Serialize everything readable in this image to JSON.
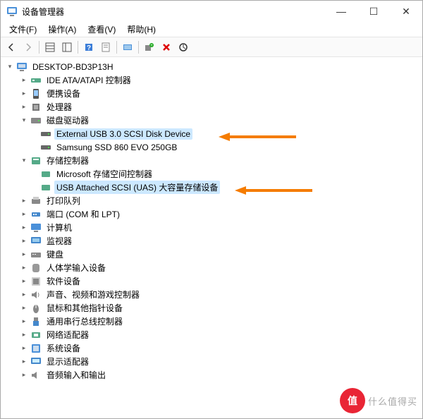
{
  "window_title": "设备管理器",
  "menus": {
    "file": "文件(F)",
    "action": "操作(A)",
    "view": "查看(V)",
    "help": "帮助(H)"
  },
  "root": "DESKTOP-BD3P13H",
  "nodes": {
    "ide": "IDE ATA/ATAPI 控制器",
    "portable": "便携设备",
    "cpu": "处理器",
    "disk": "磁盘驱动器",
    "disk1": "External USB 3.0 SCSI Disk Device",
    "disk2": "Samsung SSD 860 EVO 250GB",
    "storage": "存储控制器",
    "stor1": "Microsoft 存储空间控制器",
    "stor2": "USB Attached SCSI (UAS) 大容量存储设备",
    "printq": "打印队列",
    "ports": "端口 (COM 和 LPT)",
    "computer": "计算机",
    "monitor": "监视器",
    "keyboard": "键盘",
    "hid": "人体学输入设备",
    "software": "软件设备",
    "sound": "声音、视频和游戏控制器",
    "mouse": "鼠标和其他指针设备",
    "usb": "通用串行总线控制器",
    "network": "网络适配器",
    "system": "系统设备",
    "display": "显示适配器",
    "audio": "音频输入和输出"
  },
  "watermark": {
    "logo": "值",
    "text": "什么值得买"
  }
}
